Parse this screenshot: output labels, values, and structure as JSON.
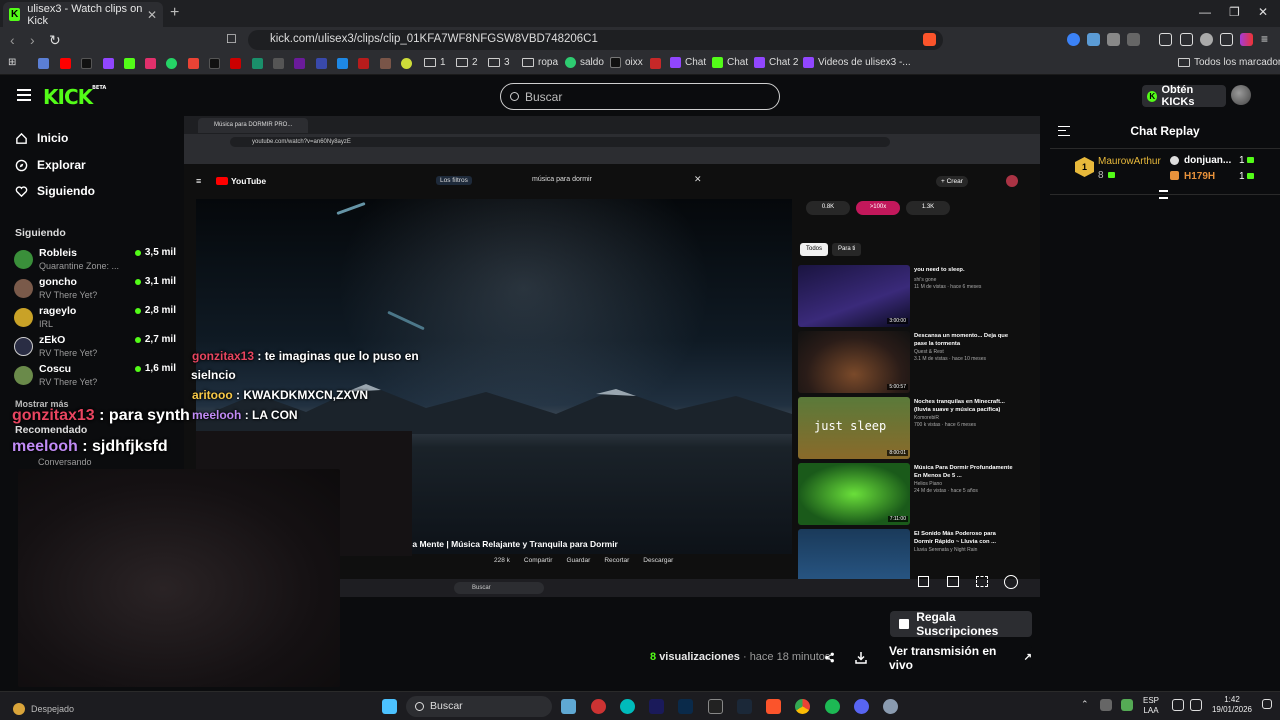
{
  "browser": {
    "tab_title": "ulisex3 - Watch clips on Kick",
    "url": "kick.com/ulisex3/clips/clip_01KFA7WF8NFGSW8VBD748206C1",
    "bookmarks": [
      "1",
      "2",
      "3",
      "ropa",
      "saldo",
      "oixx",
      "Chat",
      "Chat",
      "Chat 2",
      "Videos de ulisex3 -..."
    ],
    "bookmarks_right": "Todos los marcadores"
  },
  "kick": {
    "logo": "KICK",
    "logo_badge": "BETA",
    "search_placeholder": "Buscar",
    "kicks_button": "Obtén KICKs",
    "nav": [
      "Inicio",
      "Explorar",
      "Siguiendo"
    ],
    "following_title": "Siguiendo",
    "following": [
      {
        "name": "Robleis",
        "game": "Quarantine Zone: ...",
        "viewers": "3,5 mil",
        "color": "#3a8f3a"
      },
      {
        "name": "goncho",
        "game": "RV There Yet?",
        "viewers": "3,1 mil",
        "color": "#7a5a4a"
      },
      {
        "name": "rageylo",
        "game": "IRL",
        "viewers": "2,8 mil",
        "color": "#c9a227"
      },
      {
        "name": "zEkO",
        "game": "RV There Yet?",
        "viewers": "2,7 mil",
        "color": "#334"
      },
      {
        "name": "Coscu",
        "game": "RV There Yet?",
        "viewers": "1,6 mil",
        "color": "#6a8a4a"
      }
    ],
    "show_more": "Mostrar más",
    "recommended_title": "Recomendado",
    "recommended_sub": "Conversando"
  },
  "player": {
    "yt_tab_title": "Música para DORMIR PRO...",
    "yt_url": "youtube.com/watch?v=an60Ny8ayzE",
    "yt_logo": "YouTube",
    "yt_filters": "Los filtros",
    "yt_search": "música para dormir",
    "yt_create": "Crear",
    "stats": [
      "0.8K",
      ">100x",
      "1.3K"
    ],
    "chips": [
      "Todos",
      "Para ti"
    ],
    "video_caption": "la Mente | Música Relajante y Tranquila para Dormir",
    "actions": [
      "228 k",
      "Compartir",
      "Guardar",
      "Recortar",
      "Descargar"
    ],
    "recs": [
      {
        "title": "you need to sleep.",
        "meta1": "shi's gone",
        "meta2": "11 M de vistas · hace 6 meses",
        "duration": "3:00:00"
      },
      {
        "title": "Descansa un momento... Deja que pase la tormenta",
        "meta1": "Quest & Rest",
        "meta2": "3.1 M de vistas · hace 10 meses",
        "duration": "5:00:57"
      },
      {
        "title": "Noches tranquilas en Minecraft... (lluvia suave y música pacífica)",
        "meta1": "KomorebiR",
        "meta2": "700 k vistas · hace 6 meses",
        "duration": "8:00:01",
        "thumb_text": "just sleep"
      },
      {
        "title": "Música Para Dormir Profundamente En Menos De 5 ...",
        "meta1": "Helios Piano",
        "meta2": "24 M de vistas · hace 5 años",
        "duration": "7:11:00"
      },
      {
        "title": "El Sonido Más Poderoso para Dormir Rápido ~ Lluvia con ...",
        "meta1": "Lluvia Serenata y Night Rain",
        "meta2": "",
        "duration": ""
      }
    ],
    "taskbar_search": "Buscar",
    "overlay_chat": [
      {
        "user": "gonzitax13",
        "text": ": te imaginas que lo puso en",
        "cont": "sielncio"
      },
      {
        "user": "aritooo",
        "text": ": KWAKDKMXCN,ZXVN"
      },
      {
        "user": "meelooh",
        "text": ": LA CON"
      }
    ],
    "overlay_chat_big": [
      {
        "user": "gonzitax13",
        "text": ": para synth"
      },
      {
        "user": "meelooh",
        "text": ": sjdhfjksfd"
      }
    ]
  },
  "clip_info": {
    "gift_button": "Regala Suscripciones",
    "views_count": "8",
    "views_label": "visualizaciones",
    "time_label": "· hace 18 minutos",
    "watch_live": "Ver transmisión en vivo"
  },
  "chat": {
    "title": "Chat Replay",
    "leaderboard": [
      {
        "rank": "1",
        "name": "MaurowArthur",
        "count": "8"
      },
      {
        "name": "donjuan...",
        "count": "1"
      },
      {
        "name": "H179H",
        "count": "1"
      }
    ]
  },
  "taskbar": {
    "weather": "Despejado",
    "search": "Buscar",
    "lang1": "ESP",
    "lang2": "LAA",
    "time": "1:42",
    "date": "19/01/2026"
  },
  "colors": {
    "kick_green": "#53fc18",
    "bg": "#0b0c0e",
    "user_red": "#e84560",
    "user_yellow": "#f7c948",
    "user_purple": "#c08bf5"
  }
}
